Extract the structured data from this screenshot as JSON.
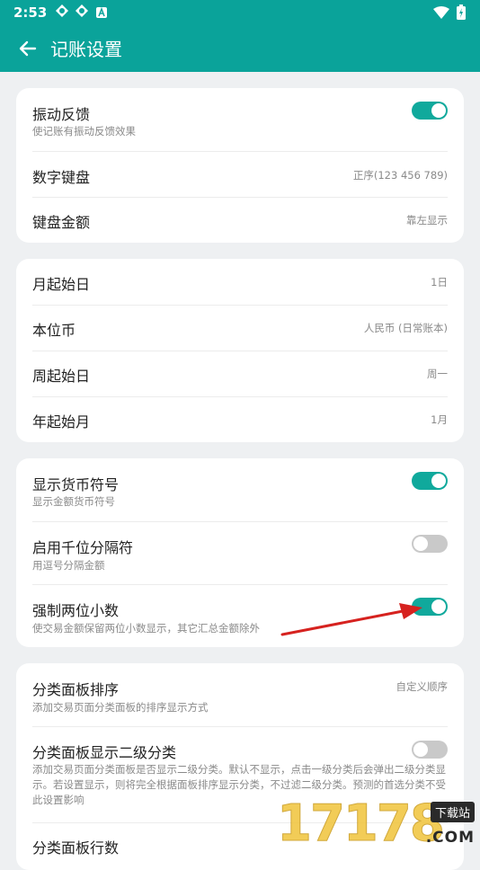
{
  "status": {
    "time": "2:53"
  },
  "header": {
    "title": "记账设置"
  },
  "card1": {
    "vibration": {
      "title": "振动反馈",
      "subtitle": "使记账有振动反馈效果",
      "enabled": true
    },
    "numeric_keyboard": {
      "title": "数字键盘",
      "value": "正序(123 456 789)"
    },
    "keyboard_amount": {
      "title": "键盘金额",
      "value": "靠左显示"
    }
  },
  "card2": {
    "month_start": {
      "title": "月起始日",
      "value": "1日"
    },
    "base_currency": {
      "title": "本位币",
      "value": "人民币 (日常账本)"
    },
    "week_start": {
      "title": "周起始日",
      "value": "周一"
    },
    "year_start": {
      "title": "年起始月",
      "value": "1月"
    }
  },
  "card3": {
    "currency_symbol": {
      "title": "显示货币符号",
      "subtitle": "显示金额货币符号",
      "enabled": true
    },
    "thousand_separator": {
      "title": "启用千位分隔符",
      "subtitle": "用逗号分隔金额",
      "enabled": false
    },
    "two_decimals": {
      "title": "强制两位小数",
      "subtitle": "使交易金额保留两位小数显示，其它汇总金额除外",
      "enabled": true
    }
  },
  "card4": {
    "category_sort": {
      "title": "分类面板排序",
      "subtitle": "添加交易页面分类面板的排序显示方式",
      "value": "自定义顺序"
    },
    "category_level2": {
      "title": "分类面板显示二级分类",
      "subtitle": "添加交易页面分类面板是否显示二级分类。默认不显示，点击一级分类后会弹出二级分类显示。若设置显示，则将完全根据面板排序显示分类，不过滤二级分类。预测的首选分类不受此设置影响",
      "enabled": false
    },
    "category_rows": {
      "title": "分类面板行数"
    }
  },
  "watermark": {
    "number": "17178",
    "badge": "下载站",
    "domain": ".COM"
  },
  "colors": {
    "accent": "#0aa39a",
    "toggle_on": "#10a99c",
    "toggle_off": "#c9c9c9",
    "annotation_arrow": "#d6221f"
  }
}
